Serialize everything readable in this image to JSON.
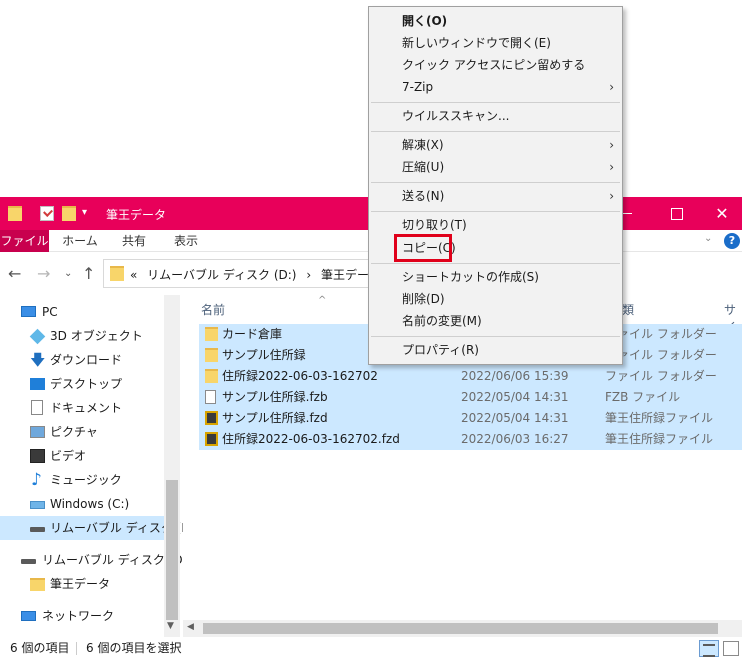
{
  "window": {
    "title": "筆王データ",
    "minimize_glyph": "",
    "close_glyph": "✕"
  },
  "colors": {
    "titlebar": "#e8005a",
    "file_tab": "#c8004e",
    "selection": "#cce8ff",
    "highlight_box": "#e0001a"
  },
  "ribbon": {
    "tabs": [
      "ファイル",
      "ホーム",
      "共有",
      "表示"
    ],
    "help": "?"
  },
  "navigation": {
    "back": "←",
    "forward": "→",
    "recent": "⌄",
    "up": "↑",
    "address": [
      "«",
      "リムーバブル ディスク (D:)",
      "›",
      "筆王データ",
      "›"
    ]
  },
  "nav_pane": {
    "items": [
      {
        "label": "PC",
        "icon": "pc-icon"
      },
      {
        "label": "3D オブジェクト",
        "icon": "3d-objects-icon"
      },
      {
        "label": "ダウンロード",
        "icon": "download-icon"
      },
      {
        "label": "デスクトップ",
        "icon": "desktop-icon"
      },
      {
        "label": "ドキュメント",
        "icon": "document-icon"
      },
      {
        "label": "ピクチャ",
        "icon": "pictures-icon"
      },
      {
        "label": "ビデオ",
        "icon": "video-icon"
      },
      {
        "label": "ミュージック",
        "icon": "music-icon"
      },
      {
        "label": "Windows (C:)",
        "icon": "windows-drive-icon"
      },
      {
        "label": "リムーバブル ディスク (D:)",
        "icon": "removable-drive-icon",
        "selected": true
      },
      {
        "label": "リムーバブル ディスク (D:)",
        "icon": "removable-drive-icon"
      },
      {
        "label": "筆王データ",
        "icon": "folder-icon"
      },
      {
        "label": "ネットワーク",
        "icon": "network-icon"
      }
    ]
  },
  "content": {
    "columns": {
      "name": "名前",
      "type": "種類",
      "size": "サイ"
    },
    "sort_indicator": "^",
    "files": [
      {
        "name": "カード倉庫",
        "date": "",
        "type": "ファイル フォルダー",
        "icon": "folder-icon"
      },
      {
        "name": "サンプル住所録",
        "date": "",
        "type": "ファイル フォルダー",
        "icon": "folder-icon"
      },
      {
        "name": "住所録2022-06-03-162702",
        "date": "2022/06/06 15:39",
        "type": "ファイル フォルダー",
        "icon": "folder-icon"
      },
      {
        "name": "サンプル住所録.fzb",
        "date": "2022/05/04 14:31",
        "type": "FZB ファイル",
        "icon": "file-icon"
      },
      {
        "name": "サンプル住所録.fzd",
        "date": "2022/05/04 14:31",
        "type": "筆王住所録ファイル",
        "icon": "fudeoh-file-icon"
      },
      {
        "name": "住所録2022-06-03-162702.fzd",
        "date": "2022/06/03 16:27",
        "type": "筆王住所録ファイル",
        "icon": "fudeoh-file-icon"
      }
    ]
  },
  "status": {
    "count": "6 個の項目",
    "selected": "6 個の項目を選択"
  },
  "context_menu": {
    "items": [
      {
        "label": "開く(O)",
        "bold": true,
        "submenu": false
      },
      {
        "label": "新しいウィンドウで開く(E)",
        "submenu": false
      },
      {
        "label": "クイック アクセスにピン留めする",
        "submenu": false
      },
      {
        "label": "7-Zip",
        "submenu": true
      },
      {
        "label": "ウイルススキャン...",
        "submenu": false
      },
      {
        "label": "解凍(X)",
        "submenu": true
      },
      {
        "label": "圧縮(U)",
        "submenu": true
      },
      {
        "label": "送る(N)",
        "submenu": true
      },
      {
        "label": "切り取り(T)",
        "submenu": false
      },
      {
        "label": "コピー(C)",
        "submenu": false,
        "highlighted": true
      },
      {
        "label": "ショートカットの作成(S)",
        "submenu": false
      },
      {
        "label": "削除(D)",
        "submenu": false
      },
      {
        "label": "名前の変更(M)",
        "submenu": false
      },
      {
        "label": "プロパティ(R)",
        "submenu": false
      }
    ],
    "submenu_arrow": "›"
  }
}
